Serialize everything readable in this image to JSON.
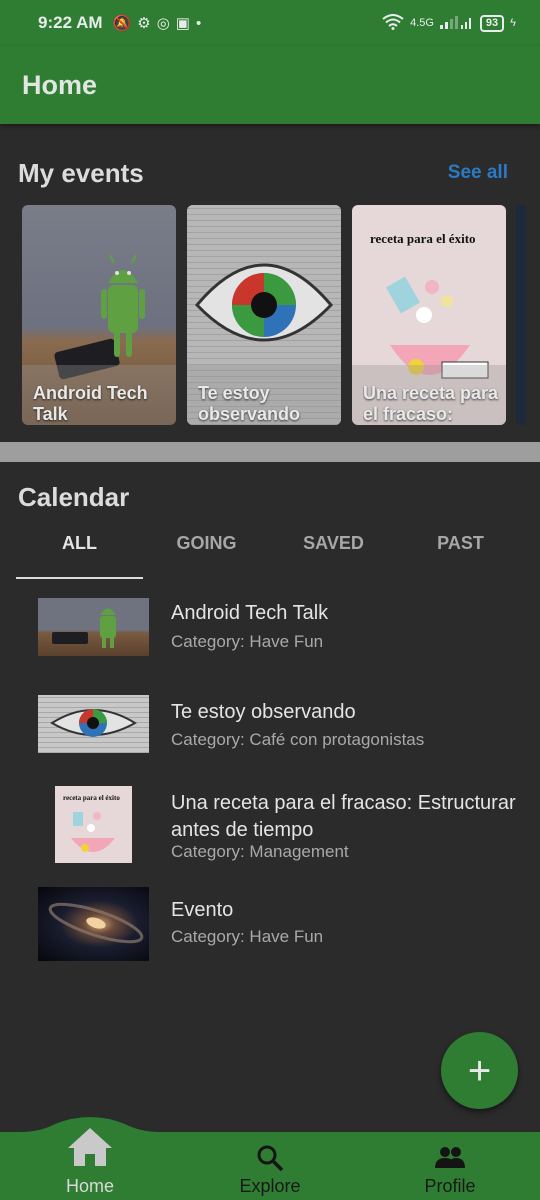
{
  "status_bar": {
    "time": "9:22 AM",
    "network": "4.5G",
    "battery": "93"
  },
  "app_bar": {
    "title": "Home"
  },
  "my_events": {
    "title": "My events",
    "see_all": "See all",
    "cards": [
      {
        "title": "Android Tech Talk"
      },
      {
        "title": "Te estoy observando"
      },
      {
        "title": "Una receta para el fracaso:"
      }
    ]
  },
  "calendar": {
    "title": "Calendar",
    "tabs": [
      "ALL",
      "GOING",
      "SAVED",
      "PAST"
    ],
    "active_tab": "ALL",
    "items": [
      {
        "title": "Android Tech Talk",
        "category": "Category: Have Fun"
      },
      {
        "title": "Te estoy observando",
        "category": "Category: Café con protagonistas"
      },
      {
        "title": "Una receta para el fracaso: Estructurar antes de tiempo",
        "category": "Category: Management"
      },
      {
        "title": "Evento",
        "category": "Category: Have Fun"
      }
    ]
  },
  "fab": {
    "icon": "plus-icon"
  },
  "bottom_nav": {
    "items": [
      {
        "label": "Home",
        "icon": "home-icon"
      },
      {
        "label": "Explore",
        "icon": "search-icon"
      },
      {
        "label": "Profile",
        "icon": "people-icon"
      }
    ]
  },
  "colors": {
    "primary": "#2f7d32",
    "background": "#2b2b2b",
    "link": "#2a7bc6"
  }
}
